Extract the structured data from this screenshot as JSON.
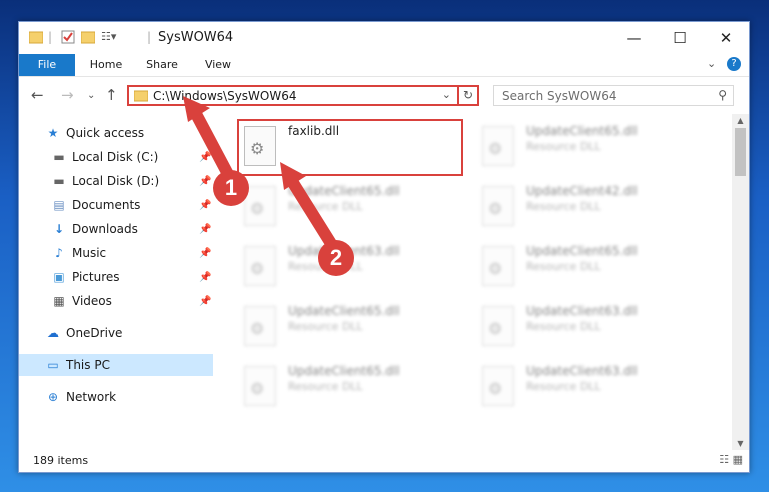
{
  "window": {
    "title": "SysWOW64"
  },
  "ribbon": {
    "tabs": [
      "File",
      "Home",
      "Share",
      "View"
    ]
  },
  "address": {
    "path": "C:\\Windows\\SysWOW64"
  },
  "search": {
    "placeholder": "Search SysWOW64"
  },
  "nav": {
    "quick_access": "Quick access",
    "items": [
      "Local Disk (C:)",
      "Local Disk (D:)",
      "Documents",
      "Downloads",
      "Music",
      "Pictures",
      "Videos"
    ],
    "onedrive": "OneDrive",
    "thispc": "This PC",
    "network": "Network"
  },
  "files": [
    {
      "name": "faxlib.dll",
      "desc": ""
    },
    {
      "name": "UpdateClient65.dll",
      "desc": "Resource DLL"
    },
    {
      "name": "UpdateClient65.dll",
      "desc": "Resource DLL"
    },
    {
      "name": "UpdateClient42.dll",
      "desc": "Resource DLL"
    },
    {
      "name": "UpdateClient63.dll",
      "desc": "Resource DLL"
    },
    {
      "name": "UpdateClient65.dll",
      "desc": "Resource DLL"
    },
    {
      "name": "UpdateClient65.dll",
      "desc": "Resource DLL"
    },
    {
      "name": "UpdateClient63.dll",
      "desc": "Resource DLL"
    },
    {
      "name": "UpdateClient65.dll",
      "desc": "Resource DLL"
    },
    {
      "name": "UpdateClient63.dll",
      "desc": "Resource DLL"
    }
  ],
  "status": {
    "count": "189 items"
  },
  "annotations": {
    "one": "1",
    "two": "2"
  },
  "colors": {
    "accent": "#1979ca",
    "highlight": "#d9413c",
    "selected": "#cce8ff"
  }
}
